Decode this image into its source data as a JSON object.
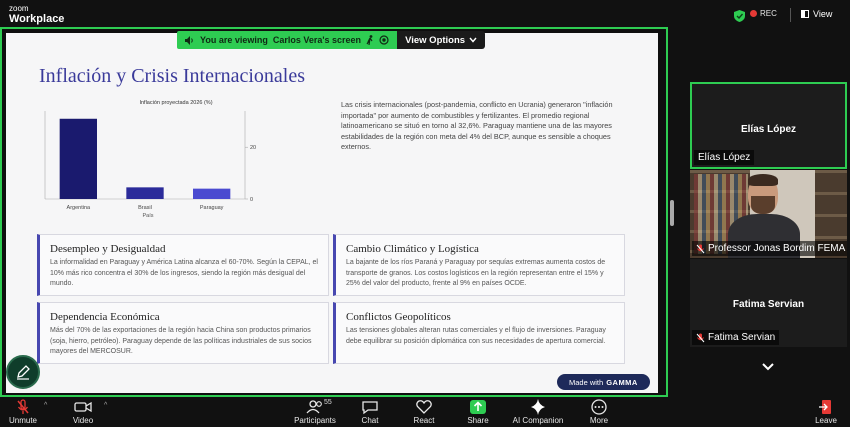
{
  "app": {
    "logo_line1": "zoom",
    "logo_line2": "Workplace",
    "rec_label": "REC",
    "view_label": "View"
  },
  "sharebar": {
    "prefix": "You are viewing",
    "presenter": "Carlos Vera's screen",
    "options_label": "View Options"
  },
  "slide": {
    "title": "Inflación y Crisis Internacionales",
    "intro": "Las crisis internacionales (post-pandemia, conflicto en Ucrania) generaron \"inflación importada\" por aumento de combustibles y fertilizantes. El promedio regional latinoamericano se situó en torno al 32,6%. Paraguay mantiene una de las mayores estabilidades de la región con meta del 4% del BCP, aunque es sensible a choques externos.",
    "cards": [
      {
        "title": "Desempleo y Desigualdad",
        "body": "La informalidad en Paraguay y América Latina alcanza el 60-70%. Según la CEPAL, el 10% más rico concentra el 30% de los ingresos, siendo la región más desigual del mundo."
      },
      {
        "title": "Cambio Climático y Logística",
        "body": "La bajante de los ríos Paraná y Paraguay por sequías extremas aumenta costos de transporte de granos. Los costos logísticos en la región representan entre el 15% y 25% del valor del producto, frente al 9% en países OCDE."
      },
      {
        "title": "Dependencia Económica",
        "body": "Más del 70% de las exportaciones de la región hacia China son productos primarios (soja, hierro, petróleo). Paraguay depende de las políticas industriales de sus socios mayores del MERCOSUR."
      },
      {
        "title": "Conflictos Geopolíticos",
        "body": "Las tensiones globales alteran rutas comerciales y el flujo de inversiones. Paraguay debe equilibrar su posición diplomática con sus necesidades de apertura comercial."
      }
    ],
    "badge_prefix": "Made with",
    "badge_brand": "GAMMA"
  },
  "chart_data": {
    "type": "bar",
    "title": "Inflación proyectada 2026 (%)",
    "xlabel": "País",
    "ylabel": "",
    "categories": [
      "Argentina",
      "Brasil",
      "Paraguay"
    ],
    "values": [
      31,
      4.5,
      4
    ],
    "colors": [
      "#1a1a6e",
      "#2b2b9a",
      "#4a4ad0"
    ],
    "yticks": [
      0,
      20
    ],
    "ylim": [
      0,
      34
    ],
    "grid": false
  },
  "participants": [
    {
      "center_name": "Elías López",
      "tag": "Elías López",
      "muted": false
    },
    {
      "center_name": "",
      "tag": "Professor Jonas Bordim FEMA",
      "muted": true
    },
    {
      "center_name": "Fatima Servian",
      "tag": "Fatima Servian",
      "muted": true
    }
  ],
  "toolbar": {
    "unmute": "Unmute",
    "video": "Video",
    "participants": "Participants",
    "participants_count": "55",
    "chat": "Chat",
    "react": "React",
    "share": "Share",
    "companion": "AI Companion",
    "more": "More",
    "leave": "Leave"
  },
  "colors": {
    "accent": "#2ecc52",
    "title": "#3a3a9a",
    "card_border": "#4747b0"
  }
}
